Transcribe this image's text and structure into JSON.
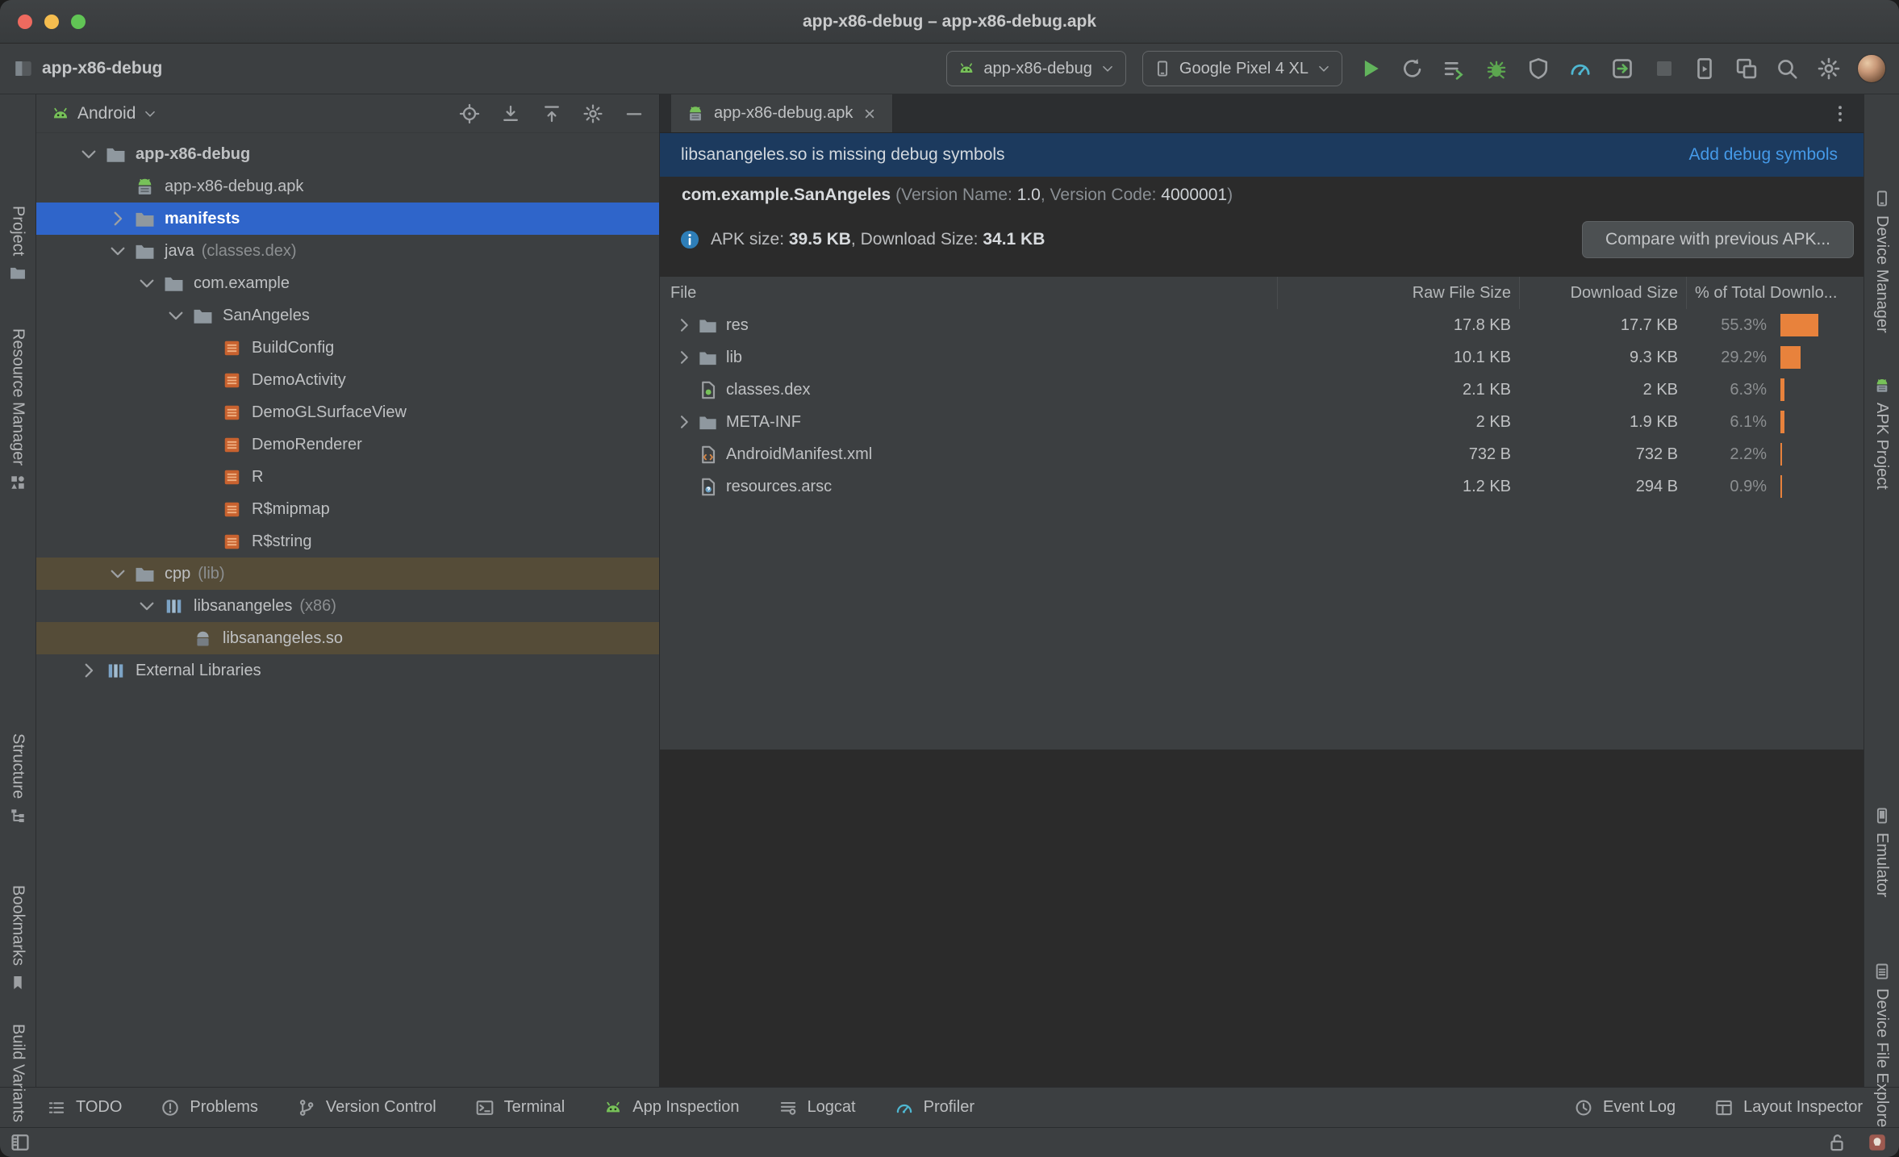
{
  "titlebar": {
    "title": "app-x86-debug – app-x86-debug.apk"
  },
  "toolbar": {
    "project_name": "app-x86-debug",
    "run_config": {
      "label": "app-x86-debug",
      "icon": "android-head"
    },
    "device": {
      "label": "Google Pixel 4 XL",
      "icon": "phone"
    },
    "action_icons": [
      "run",
      "rerun",
      "apply-changes",
      "debug",
      "profile",
      "profiler",
      "attach-debugger",
      "stop"
    ],
    "device_icons": [
      "running-devices",
      "device-mirroring"
    ],
    "misc_icons": [
      "search",
      "settings-gear"
    ]
  },
  "left_strip": {
    "items": [
      {
        "label": "Project",
        "icon": "project"
      },
      {
        "label": "Resource Manager",
        "icon": "resource-manager"
      },
      {
        "label": "Structure",
        "icon": "structure"
      },
      {
        "label": "Bookmarks",
        "icon": "bookmarks"
      },
      {
        "label": "Build Variants",
        "icon": null
      }
    ]
  },
  "right_strip": {
    "items": [
      {
        "label": "Device Manager",
        "icon": "device-manager"
      },
      {
        "label": "APK Project",
        "icon": "apk-project"
      },
      {
        "label": "Emulator",
        "icon": "emulator"
      },
      {
        "label": "Device File Explorer",
        "icon": "device-file-explorer"
      }
    ]
  },
  "project_panel": {
    "selector": "Android",
    "header_icons": [
      "locate",
      "expand-all",
      "collapse-all",
      "settings-gear",
      "hide"
    ],
    "tree": [
      {
        "label": "app-x86-debug",
        "depth": 0,
        "icon": "folder",
        "chevron": "down",
        "bold": true
      },
      {
        "label": "app-x86-debug.apk",
        "depth": 1,
        "icon": "apk"
      },
      {
        "label": "manifests",
        "depth": 1,
        "icon": "folder",
        "chevron": "right",
        "selected": true,
        "bold": true
      },
      {
        "label": "java",
        "suffix": "(classes.dex)",
        "depth": 1,
        "icon": "folder",
        "chevron": "down"
      },
      {
        "label": "com.example",
        "depth": 2,
        "icon": "folder",
        "chevron": "down"
      },
      {
        "label": "SanAngeles",
        "depth": 3,
        "icon": "folder",
        "chevron": "down"
      },
      {
        "label": "BuildConfig",
        "depth": 4,
        "icon": "class"
      },
      {
        "label": "DemoActivity",
        "depth": 4,
        "icon": "class"
      },
      {
        "label": "DemoGLSurfaceView",
        "depth": 4,
        "icon": "class"
      },
      {
        "label": "DemoRenderer",
        "depth": 4,
        "icon": "class"
      },
      {
        "label": "R",
        "depth": 4,
        "icon": "class"
      },
      {
        "label": "R$mipmap",
        "depth": 4,
        "icon": "class"
      },
      {
        "label": "R$string",
        "depth": 4,
        "icon": "class"
      },
      {
        "label": "cpp",
        "suffix": "(lib)",
        "depth": 1,
        "icon": "folder",
        "chevron": "down",
        "highlight": true
      },
      {
        "label": "libsanangeles",
        "suffix": "(x86)",
        "depth": 2,
        "icon": "lib",
        "chevron": "down"
      },
      {
        "label": "libsanangeles.so",
        "depth": 3,
        "icon": "so",
        "highlight": true
      },
      {
        "label": "External Libraries",
        "depth": 0,
        "icon": "lib-root",
        "chevron": "right"
      }
    ]
  },
  "editor": {
    "tab": {
      "label": "app-x86-debug.apk",
      "icon": "apk"
    },
    "banner": {
      "message": "libsanangeles.so is missing debug symbols",
      "action": "Add debug symbols"
    },
    "package_line": {
      "name": "com.example.SanAngeles",
      "version_name_label": "(Version Name: ",
      "version_name": "1.0",
      "version_code_label": ", Version Code: ",
      "version_code": "4000001",
      "close_paren": ")"
    },
    "size_line": {
      "apk_label": "APK size: ",
      "apk_size": "39.5 KB",
      "download_label": ", Download Size: ",
      "download_size": "34.1 KB"
    },
    "compare_button": "Compare with previous APK...",
    "table": {
      "columns": [
        "File",
        "Raw File Size",
        "Download Size",
        "% of Total Downlo..."
      ],
      "rows": [
        {
          "name": "res",
          "icon": "folder",
          "expandable": true,
          "raw": "17.8 KB",
          "download": "17.7 KB",
          "pct": "55.3%",
          "bar": 55.3
        },
        {
          "name": "lib",
          "icon": "folder",
          "expandable": true,
          "raw": "10.1 KB",
          "download": "9.3 KB",
          "pct": "29.2%",
          "bar": 29.2
        },
        {
          "name": "classes.dex",
          "icon": "file-dex",
          "expandable": false,
          "raw": "2.1 KB",
          "download": "2 KB",
          "pct": "6.3%",
          "bar": 6.3
        },
        {
          "name": "META-INF",
          "icon": "folder",
          "expandable": true,
          "raw": "2 KB",
          "download": "1.9 KB",
          "pct": "6.1%",
          "bar": 6.1
        },
        {
          "name": "AndroidManifest.xml",
          "icon": "file-xml",
          "expandable": false,
          "raw": "732 B",
          "download": "732 B",
          "pct": "2.2%",
          "bar": 2.2
        },
        {
          "name": "resources.arsc",
          "icon": "file-arsc",
          "expandable": false,
          "raw": "1.2 KB",
          "download": "294 B",
          "pct": "0.9%",
          "bar": 0.9
        }
      ]
    }
  },
  "bottom_bar": {
    "left": [
      {
        "label": "TODO",
        "icon": "todo"
      },
      {
        "label": "Problems",
        "icon": "problems"
      },
      {
        "label": "Version Control",
        "icon": "version-control"
      },
      {
        "label": "Terminal",
        "icon": "terminal"
      },
      {
        "label": "App Inspection",
        "icon": "app-inspection"
      },
      {
        "label": "Logcat",
        "icon": "logcat"
      },
      {
        "label": "Profiler",
        "icon": "profiler-bottom"
      }
    ],
    "right": [
      {
        "label": "Event Log",
        "icon": "event-log"
      },
      {
        "label": "Layout Inspector",
        "icon": "layout-inspector"
      }
    ]
  },
  "status_bar": {
    "left_icon": "stripe-toggle",
    "right_icons": [
      "lock",
      "notifications"
    ]
  },
  "colors": {
    "selection_blue": "#2f65ca",
    "highlight_brown": "#554c38",
    "banner_bg": "#1c3a5e",
    "link_blue": "#459ae8",
    "bar_orange": "#e8823c",
    "run_green": "#62b45c"
  }
}
